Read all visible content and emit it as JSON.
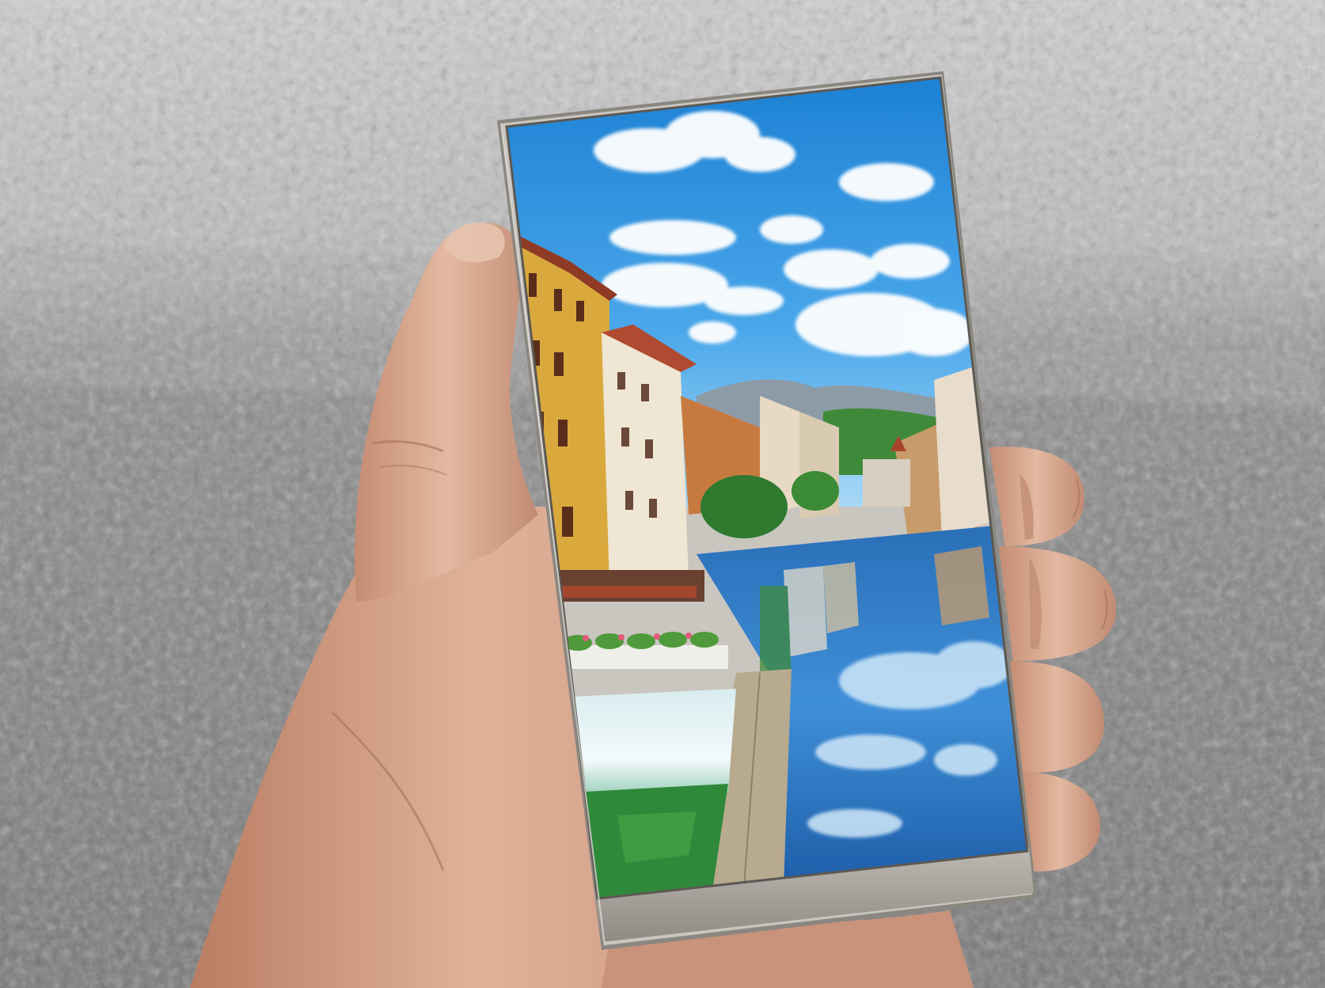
{
  "image": {
    "subject": "hand-holding-bezel-less-phone",
    "screen_scene": "canal-town-reflection",
    "palette": {
      "carpet_light": "#c9c9c9",
      "carpet_mid": "#9a9a9a",
      "carpet_dark": "#6e6e6e",
      "skin_light": "#e0b49a",
      "skin_mid": "#c98f72",
      "skin_dark": "#9c6a55",
      "sky_top": "#1f86d6",
      "sky_bottom": "#7cc4f4",
      "cloud": "#ffffff",
      "mountain": "#8c9aa6",
      "forest": "#3f8a3a",
      "building_yellow": "#d6a63a",
      "building_cream": "#efe6d2",
      "building_orange": "#c8773b",
      "roof_red": "#a8442c",
      "water_deep": "#1c5aa6",
      "water_reflect": "#6fb3e9",
      "weir_white": "#e9f3f4",
      "pool_green": "#2f8a3a",
      "walkway": "#b9ab90",
      "phone_frame": "#b7b3ad",
      "phone_chin": "#a8a39d"
    }
  }
}
